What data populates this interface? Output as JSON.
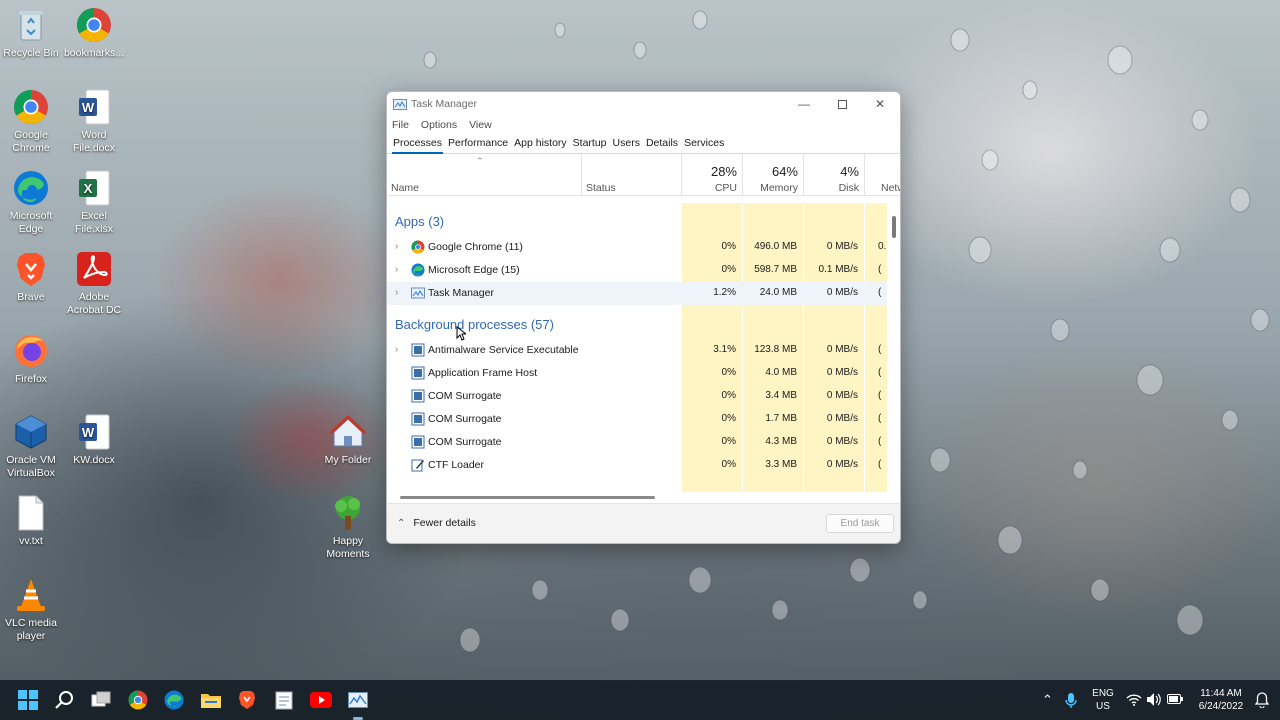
{
  "desktop": {
    "icons": [
      {
        "label": "Recycle Bin"
      },
      {
        "label": "bookmarks..."
      },
      {
        "label": "Google Chrome"
      },
      {
        "label": "Word File.docx"
      },
      {
        "label": "Microsoft Edge"
      },
      {
        "label": "Excel File.xlsx"
      },
      {
        "label": "Brave"
      },
      {
        "label": "Adobe Acrobat DC"
      },
      {
        "label": "Firefox"
      },
      {
        "label": "Oracle VM VirtualBox"
      },
      {
        "label": "KW.docx"
      },
      {
        "label": "My Folder"
      },
      {
        "label": "vv.txt"
      },
      {
        "label": "Happy Moments"
      },
      {
        "label": "VLC media player"
      }
    ]
  },
  "task_manager": {
    "title": "Task Manager",
    "menu": [
      "File",
      "Options",
      "View"
    ],
    "tabs": [
      "Processes",
      "Performance",
      "App history",
      "Startup",
      "Users",
      "Details",
      "Services"
    ],
    "active_tab": "Processes",
    "columns": {
      "name": "Name",
      "status": "Status",
      "cpu": {
        "pct": "28%",
        "label": "CPU"
      },
      "memory": {
        "pct": "64%",
        "label": "Memory"
      },
      "disk": {
        "pct": "4%",
        "label": "Disk"
      },
      "network": {
        "label": "Netw"
      }
    },
    "groups": {
      "apps": "Apps (3)",
      "background": "Background processes (57)"
    },
    "apps": [
      {
        "name": "Google Chrome (11)",
        "cpu": "0%",
        "memory": "496.0 MB",
        "disk": "0 MB/s",
        "network": "0."
      },
      {
        "name": "Microsoft Edge (15)",
        "cpu": "0%",
        "memory": "598.7 MB",
        "disk": "0.1 MB/s",
        "network": "("
      },
      {
        "name": "Task Manager",
        "cpu": "1.2%",
        "memory": "24.0 MB",
        "disk": "0 MB/s",
        "network": "("
      }
    ],
    "background": [
      {
        "name": "Antimalware Service Executable",
        "cpu": "3.1%",
        "memory": "123.8 MB",
        "disk": "0 MB/s",
        "network": "("
      },
      {
        "name": "Application Frame Host",
        "cpu": "0%",
        "memory": "4.0 MB",
        "disk": "0 MB/s",
        "network": "("
      },
      {
        "name": "COM Surrogate",
        "cpu": "0%",
        "memory": "3.4 MB",
        "disk": "0 MB/s",
        "network": "("
      },
      {
        "name": "COM Surrogate",
        "cpu": "0%",
        "memory": "1.7 MB",
        "disk": "0 MB/s",
        "network": "("
      },
      {
        "name": "COM Surrogate",
        "cpu": "0%",
        "memory": "4.3 MB",
        "disk": "0 MB/s",
        "network": "("
      },
      {
        "name": "CTF Loader",
        "cpu": "0%",
        "memory": "3.3 MB",
        "disk": "0 MB/s",
        "network": "("
      }
    ],
    "fewer_details": "Fewer details",
    "end_task": "End task"
  },
  "tray": {
    "lang": "ENG",
    "region": "US",
    "time": "11:44 AM",
    "date": "6/24/2022"
  }
}
